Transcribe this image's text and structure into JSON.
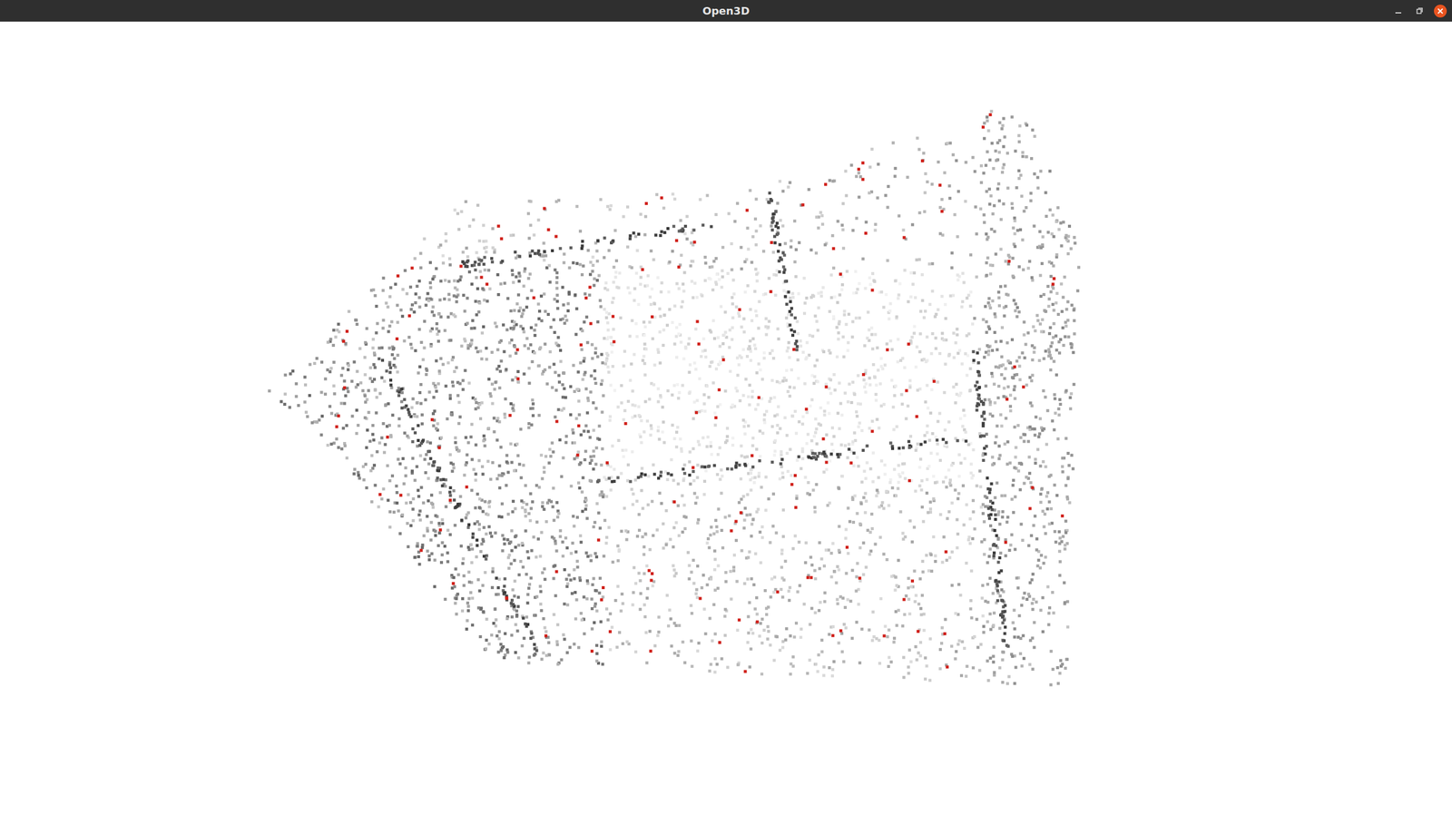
{
  "window": {
    "title": "Open3D"
  }
}
